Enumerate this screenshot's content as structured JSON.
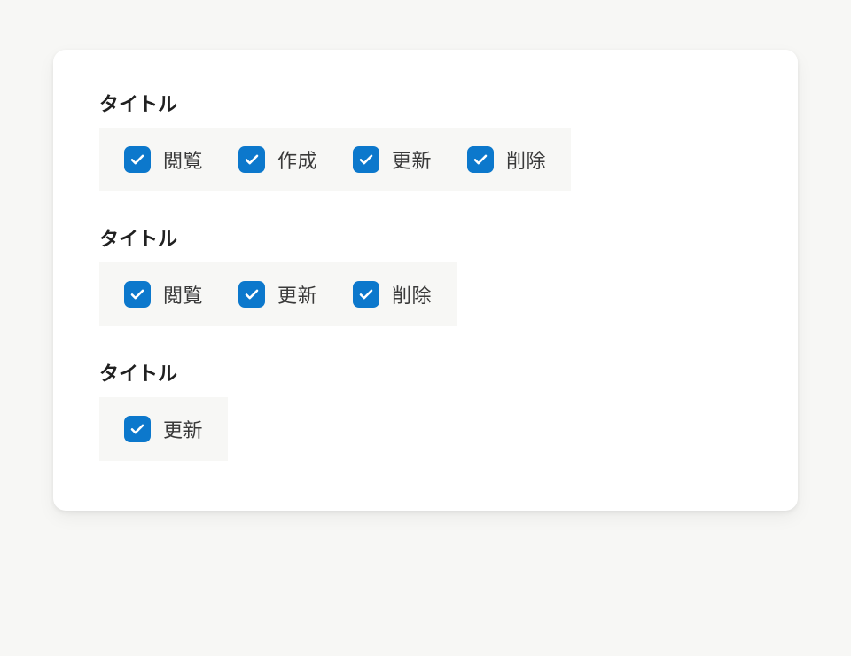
{
  "groups": [
    {
      "title": "タイトル",
      "options": [
        {
          "label": "閲覧",
          "checked": true
        },
        {
          "label": "作成",
          "checked": true
        },
        {
          "label": "更新",
          "checked": true
        },
        {
          "label": "削除",
          "checked": true
        }
      ]
    },
    {
      "title": "タイトル",
      "options": [
        {
          "label": "閲覧",
          "checked": true
        },
        {
          "label": "更新",
          "checked": true
        },
        {
          "label": "削除",
          "checked": true
        }
      ]
    },
    {
      "title": "タイトル",
      "options": [
        {
          "label": "更新",
          "checked": true
        }
      ]
    }
  ],
  "colors": {
    "accent": "#0c78cc",
    "card_bg": "#ffffff",
    "page_bg": "#f7f7f5",
    "option_bg": "#f7f7f5"
  }
}
